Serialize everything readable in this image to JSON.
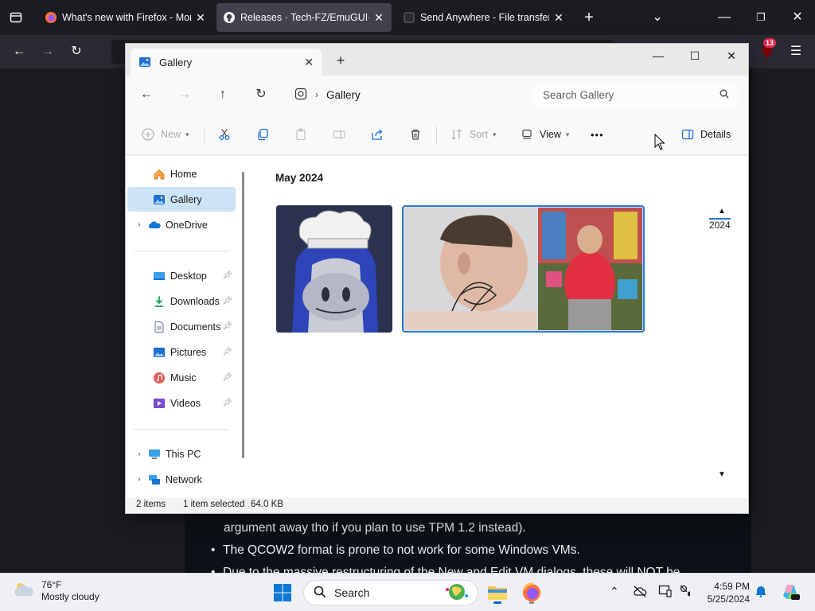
{
  "browser": {
    "tabs": [
      {
        "title": "What's new with Firefox - More",
        "active": false
      },
      {
        "title": "Releases · Tech-FZ/EmuGUI-Pre",
        "active": true
      },
      {
        "title": "Send Anywhere - File transfer",
        "active": false
      }
    ],
    "extension_badge": "13"
  },
  "webpage": {
    "lines": [
      "argument away tho if you plan to use TPM 1.2 instead).",
      "The QCOW2 format is prone to not work for some Windows VMs.",
      "Due to the massive restructuring of the New and Edit VM dialogs, these will NOT be"
    ]
  },
  "explorer": {
    "tab_title": "Gallery",
    "breadcrumb": "Gallery",
    "search_placeholder": "Search Gallery",
    "commands": {
      "new": "New",
      "sort": "Sort",
      "view": "View",
      "more": "•••",
      "details": "Details"
    },
    "nav": {
      "home": "Home",
      "gallery": "Gallery",
      "onedrive": "OneDrive",
      "desktop": "Desktop",
      "downloads": "Downloads",
      "documents": "Documents",
      "pictures": "Pictures",
      "music": "Music",
      "videos": "Videos",
      "thispc": "This PC",
      "network": "Network"
    },
    "group_header": "May 2024",
    "timeline_year": "2024",
    "status": {
      "items": "2 items",
      "selected": "1 item selected",
      "size": "64.0 KB"
    }
  },
  "taskbar": {
    "weather_temp": "76°F",
    "weather_desc": "Mostly cloudy",
    "search_label": "Search",
    "time": "4:59 PM",
    "date": "5/25/2024"
  },
  "colors": {
    "accent": "#0067c0",
    "selection": "#cce4f7",
    "firefox_dark": "#1c1b22"
  }
}
